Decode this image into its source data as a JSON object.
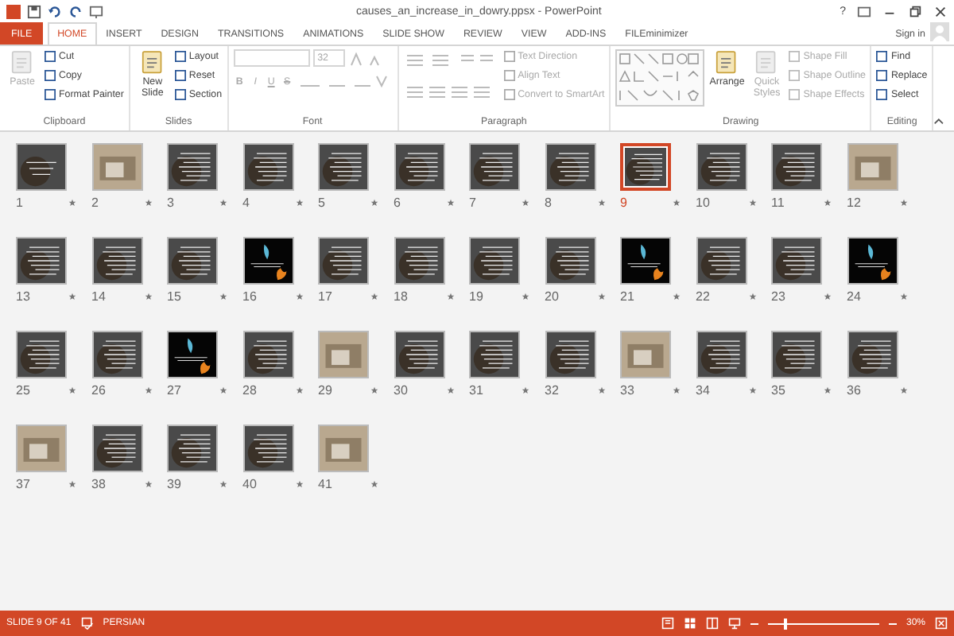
{
  "window": {
    "title": "causes_an_increase_in_dowry.ppsx - PowerPoint",
    "help": "?",
    "sign_in": "Sign in"
  },
  "tabs": [
    {
      "label": "FILE",
      "kind": "file",
      "selected": false
    },
    {
      "label": "HOME",
      "kind": "tab",
      "selected": true
    },
    {
      "label": "INSERT",
      "kind": "tab",
      "selected": false
    },
    {
      "label": "DESIGN",
      "kind": "tab",
      "selected": false
    },
    {
      "label": "TRANSITIONS",
      "kind": "tab",
      "selected": false
    },
    {
      "label": "ANIMATIONS",
      "kind": "tab",
      "selected": false
    },
    {
      "label": "SLIDE SHOW",
      "kind": "tab",
      "selected": false
    },
    {
      "label": "REVIEW",
      "kind": "tab",
      "selected": false
    },
    {
      "label": "VIEW",
      "kind": "tab",
      "selected": false
    },
    {
      "label": "ADD-INS",
      "kind": "tab",
      "selected": false
    },
    {
      "label": "FILEminimizer",
      "kind": "tab",
      "selected": false
    }
  ],
  "ribbon": [
    {
      "name": "Clipboard",
      "large": [
        {
          "label": "Paste",
          "disabled": true
        }
      ],
      "small": [
        {
          "label": "Cut",
          "disabled": false
        },
        {
          "label": "Copy",
          "disabled": false
        },
        {
          "label": "Format Painter",
          "disabled": false
        }
      ]
    },
    {
      "name": "Slides",
      "large": [
        {
          "label": "New Slide",
          "disabled": false
        }
      ],
      "small": [
        {
          "label": "Layout",
          "disabled": false
        },
        {
          "label": "Reset",
          "disabled": false
        },
        {
          "label": "Section",
          "disabled": false
        }
      ]
    },
    {
      "name": "Font",
      "kind": "font",
      "font_size": "32",
      "format_buttons": [
        "B",
        "I",
        "U",
        "S"
      ]
    },
    {
      "name": "Paragraph",
      "kind": "paragraph",
      "small": [
        {
          "label": "Text Direction",
          "disabled": true
        },
        {
          "label": "Align Text",
          "disabled": true
        },
        {
          "label": "Convert to SmartArt",
          "disabled": true
        }
      ]
    },
    {
      "name": "Drawing",
      "kind": "drawing",
      "large": [
        {
          "label": "Arrange",
          "disabled": false
        },
        {
          "label": "Quick Styles",
          "disabled": true
        }
      ],
      "small": [
        {
          "label": "Shape Fill",
          "disabled": true
        },
        {
          "label": "Shape Outline",
          "disabled": true
        },
        {
          "label": "Shape Effects",
          "disabled": true
        }
      ]
    },
    {
      "name": "Editing",
      "small": [
        {
          "label": "Find",
          "disabled": false
        },
        {
          "label": "Replace",
          "disabled": false
        },
        {
          "label": "Select",
          "disabled": false
        }
      ]
    }
  ],
  "slides": [
    {
      "number": "1",
      "kind": "title",
      "selected": false
    },
    {
      "number": "2",
      "kind": "photo",
      "selected": false
    },
    {
      "number": "3",
      "kind": "text",
      "selected": false
    },
    {
      "number": "4",
      "kind": "text",
      "selected": false
    },
    {
      "number": "5",
      "kind": "text",
      "selected": false
    },
    {
      "number": "6",
      "kind": "text",
      "selected": false
    },
    {
      "number": "7",
      "kind": "text",
      "selected": false
    },
    {
      "number": "8",
      "kind": "text",
      "selected": false
    },
    {
      "number": "9",
      "kind": "text",
      "selected": true
    },
    {
      "number": "10",
      "kind": "text",
      "selected": false
    },
    {
      "number": "11",
      "kind": "text",
      "selected": false
    },
    {
      "number": "12",
      "kind": "photo",
      "selected": false
    },
    {
      "number": "13",
      "kind": "text",
      "selected": false
    },
    {
      "number": "14",
      "kind": "text",
      "selected": false
    },
    {
      "number": "15",
      "kind": "text",
      "selected": false
    },
    {
      "number": "16",
      "kind": "fire",
      "selected": false
    },
    {
      "number": "17",
      "kind": "text",
      "selected": false
    },
    {
      "number": "18",
      "kind": "text",
      "selected": false
    },
    {
      "number": "19",
      "kind": "text",
      "selected": false
    },
    {
      "number": "20",
      "kind": "text",
      "selected": false
    },
    {
      "number": "21",
      "kind": "fire",
      "selected": false
    },
    {
      "number": "22",
      "kind": "text",
      "selected": false
    },
    {
      "number": "23",
      "kind": "text",
      "selected": false
    },
    {
      "number": "24",
      "kind": "fire",
      "selected": false
    },
    {
      "number": "25",
      "kind": "text",
      "selected": false
    },
    {
      "number": "26",
      "kind": "text",
      "selected": false
    },
    {
      "number": "27",
      "kind": "fire",
      "selected": false
    },
    {
      "number": "28",
      "kind": "text",
      "selected": false
    },
    {
      "number": "29",
      "kind": "photo",
      "selected": false
    },
    {
      "number": "30",
      "kind": "text",
      "selected": false
    },
    {
      "number": "31",
      "kind": "text",
      "selected": false
    },
    {
      "number": "32",
      "kind": "text",
      "selected": false
    },
    {
      "number": "33",
      "kind": "photo",
      "selected": false
    },
    {
      "number": "34",
      "kind": "text",
      "selected": false
    },
    {
      "number": "35",
      "kind": "text",
      "selected": false
    },
    {
      "number": "36",
      "kind": "text",
      "selected": false
    },
    {
      "number": "37",
      "kind": "photo",
      "selected": false
    },
    {
      "number": "38",
      "kind": "text",
      "selected": false
    },
    {
      "number": "39",
      "kind": "text",
      "selected": false
    },
    {
      "number": "40",
      "kind": "text",
      "selected": false
    },
    {
      "number": "41",
      "kind": "photo",
      "selected": false
    }
  ],
  "status_bar": {
    "slide": "SLIDE 9 OF 41",
    "language": "PERSIAN",
    "zoom": "30%",
    "zoom_slider": {
      "level": 0.15
    }
  }
}
